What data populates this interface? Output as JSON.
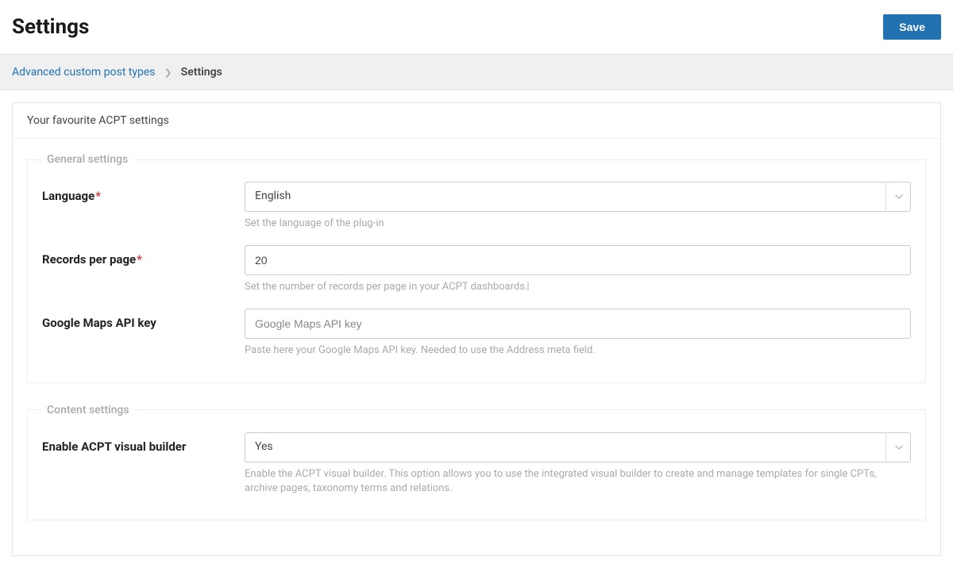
{
  "header": {
    "title": "Settings",
    "save_label": "Save"
  },
  "breadcrumb": {
    "root": "Advanced custom post types",
    "current": "Settings"
  },
  "card": {
    "intro": "Your favourite ACPT settings"
  },
  "fieldsets": {
    "general": {
      "legend": "General settings",
      "language": {
        "label": "Language",
        "value": "English",
        "help": "Set the language of the plug-in"
      },
      "records": {
        "label": "Records per page",
        "value": "20",
        "help": "Set the number of records per page in your ACPT dashboards."
      },
      "gmaps": {
        "label": "Google Maps API key",
        "placeholder": "Google Maps API key",
        "value": "",
        "help": "Paste here your Google Maps API key. Needed to use the Address meta field."
      }
    },
    "content": {
      "legend": "Content settings",
      "visual_builder": {
        "label": "Enable ACPT visual builder",
        "value": "Yes",
        "help": "Enable the ACPT visual builder. This option allows you to use the integrated visual builder to create and manage templates for single CPTs, archive pages, taxonomy terms and relations."
      }
    }
  }
}
